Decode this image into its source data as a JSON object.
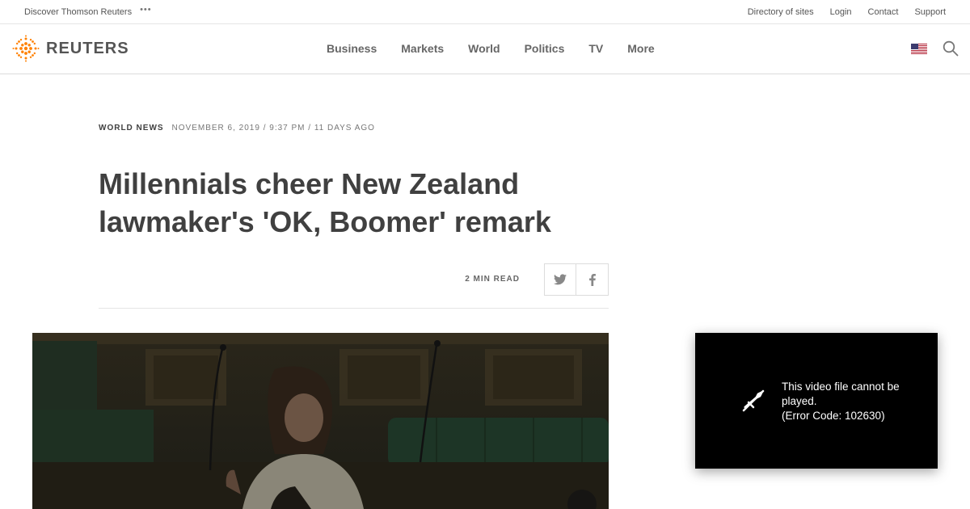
{
  "utility": {
    "discover": "Discover Thomson Reuters",
    "links": [
      "Directory of sites",
      "Login",
      "Contact",
      "Support"
    ]
  },
  "brand": {
    "name": "REUTERS"
  },
  "nav": {
    "items": [
      "Business",
      "Markets",
      "World",
      "Politics",
      "TV",
      "More"
    ]
  },
  "article": {
    "section": "WORLD NEWS",
    "date": "NOVEMBER 6, 2019 / 9:37 PM / 11 DAYS AGO",
    "headline": "Millennials cheer New Zealand lawmaker's 'OK, Boomer' remark",
    "read_time": "2 MIN READ"
  },
  "player": {
    "message_line1": "This video file cannot be played.",
    "message_line2": "(Error Code: 102630)"
  },
  "colors": {
    "brand_orange": "#ff8000",
    "text": "#404040",
    "player_bg": "#000000"
  }
}
